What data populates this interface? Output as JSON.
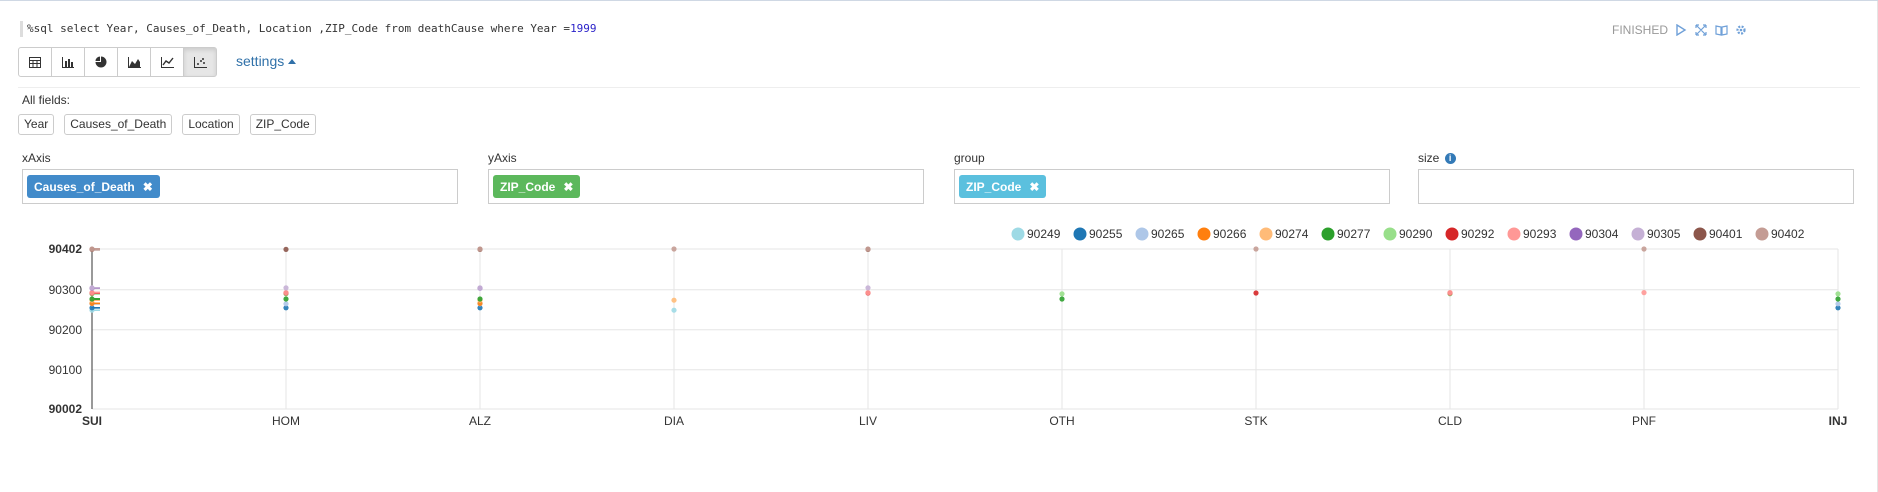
{
  "query": {
    "prefix": "%sql select Year, Causes_of_Death, Location ,ZIP_Code from deathCause where Year =",
    "value": "1999"
  },
  "status": {
    "text": "FINISHED",
    "icons": [
      "play-icon",
      "expand-icon",
      "book-icon",
      "gear-icon"
    ]
  },
  "toolbar": {
    "buttons": [
      {
        "name": "table",
        "icon": "table-icon"
      },
      {
        "name": "bar",
        "icon": "bar-chart-icon"
      },
      {
        "name": "pie",
        "icon": "pie-chart-icon"
      },
      {
        "name": "area",
        "icon": "area-chart-icon"
      },
      {
        "name": "line",
        "icon": "line-chart-icon"
      },
      {
        "name": "scatter",
        "icon": "scatter-chart-icon",
        "active": true
      }
    ],
    "settings_label": "settings"
  },
  "fields": {
    "label": "All fields:",
    "items": [
      "Year",
      "Causes_of_Death",
      "Location",
      "ZIP_Code"
    ]
  },
  "axes": {
    "xaxis": {
      "label": "xAxis",
      "tag": "Causes_of_Death",
      "color": "#428bca"
    },
    "yaxis": {
      "label": "yAxis",
      "tag": "ZIP_Code",
      "color": "#5cb85c"
    },
    "group": {
      "label": "group",
      "tag": "ZIP_Code",
      "color": "#5bc0de"
    },
    "size": {
      "label": "size",
      "tag": ""
    }
  },
  "chart_data": {
    "type": "scatter",
    "categories": [
      "SUI",
      "HOM",
      "ALZ",
      "DIA",
      "LIV",
      "OTH",
      "STK",
      "CLD",
      "PNF",
      "INJ"
    ],
    "y_ticks": [
      90002,
      90100,
      90200,
      90300,
      90402
    ],
    "ylim": [
      90002,
      90402
    ],
    "grid": true,
    "legend_position": "top-right",
    "series": [
      {
        "name": "90249",
        "color": "#9edae5",
        "points": [
          [
            "SUI",
            90249
          ],
          [
            "DIA",
            90249
          ]
        ]
      },
      {
        "name": "90255",
        "color": "#1f77b4",
        "points": [
          [
            "SUI",
            90255
          ],
          [
            "HOM",
            90255
          ],
          [
            "ALZ",
            90255
          ],
          [
            "INJ",
            90255
          ]
        ]
      },
      {
        "name": "90265",
        "color": "#aec7e8",
        "points": [
          [
            "SUI",
            90265
          ],
          [
            "HOM",
            90265
          ],
          [
            "ALZ",
            90265
          ],
          [
            "INJ",
            90265
          ]
        ]
      },
      {
        "name": "90266",
        "color": "#ff7f0e",
        "points": [
          [
            "SUI",
            90266
          ],
          [
            "ALZ",
            90266
          ]
        ]
      },
      {
        "name": "90274",
        "color": "#ffbb78",
        "points": [
          [
            "SUI",
            90274
          ],
          [
            "ALZ",
            90274
          ],
          [
            "DIA",
            90274
          ]
        ]
      },
      {
        "name": "90277",
        "color": "#2ca02c",
        "points": [
          [
            "SUI",
            90277
          ],
          [
            "HOM",
            90277
          ],
          [
            "ALZ",
            90277
          ],
          [
            "OTH",
            90277
          ],
          [
            "INJ",
            90277
          ]
        ]
      },
      {
        "name": "90290",
        "color": "#98df8a",
        "points": [
          [
            "SUI",
            90290
          ],
          [
            "HOM",
            90290
          ],
          [
            "OTH",
            90290
          ],
          [
            "CLD",
            90290
          ],
          [
            "INJ",
            90290
          ]
        ]
      },
      {
        "name": "90292",
        "color": "#d62728",
        "points": [
          [
            "SUI",
            90292
          ],
          [
            "HOM",
            90292
          ],
          [
            "LIV",
            90292
          ],
          [
            "STK",
            90292
          ],
          [
            "CLD",
            90292
          ]
        ]
      },
      {
        "name": "90293",
        "color": "#ff9896",
        "points": [
          [
            "SUI",
            90293
          ],
          [
            "HOM",
            90293
          ],
          [
            "LIV",
            90293
          ],
          [
            "CLD",
            90293
          ],
          [
            "PNF",
            90293
          ]
        ]
      },
      {
        "name": "90304",
        "color": "#9467bd",
        "points": [
          [
            "SUI",
            90304
          ],
          [
            "ALZ",
            90304
          ]
        ]
      },
      {
        "name": "90305",
        "color": "#c5b0d5",
        "points": [
          [
            "SUI",
            90305
          ],
          [
            "HOM",
            90305
          ],
          [
            "ALZ",
            90305
          ],
          [
            "LIV",
            90305
          ]
        ]
      },
      {
        "name": "90401",
        "color": "#8c564b",
        "points": [
          [
            "SUI",
            90401
          ],
          [
            "HOM",
            90401
          ],
          [
            "ALZ",
            90401
          ],
          [
            "LIV",
            90401
          ]
        ]
      },
      {
        "name": "90402",
        "color": "#c49c94",
        "points": [
          [
            "SUI",
            90402
          ],
          [
            "ALZ",
            90402
          ],
          [
            "DIA",
            90402
          ],
          [
            "LIV",
            90402
          ],
          [
            "STK",
            90402
          ],
          [
            "PNF",
            90402
          ]
        ]
      }
    ]
  }
}
